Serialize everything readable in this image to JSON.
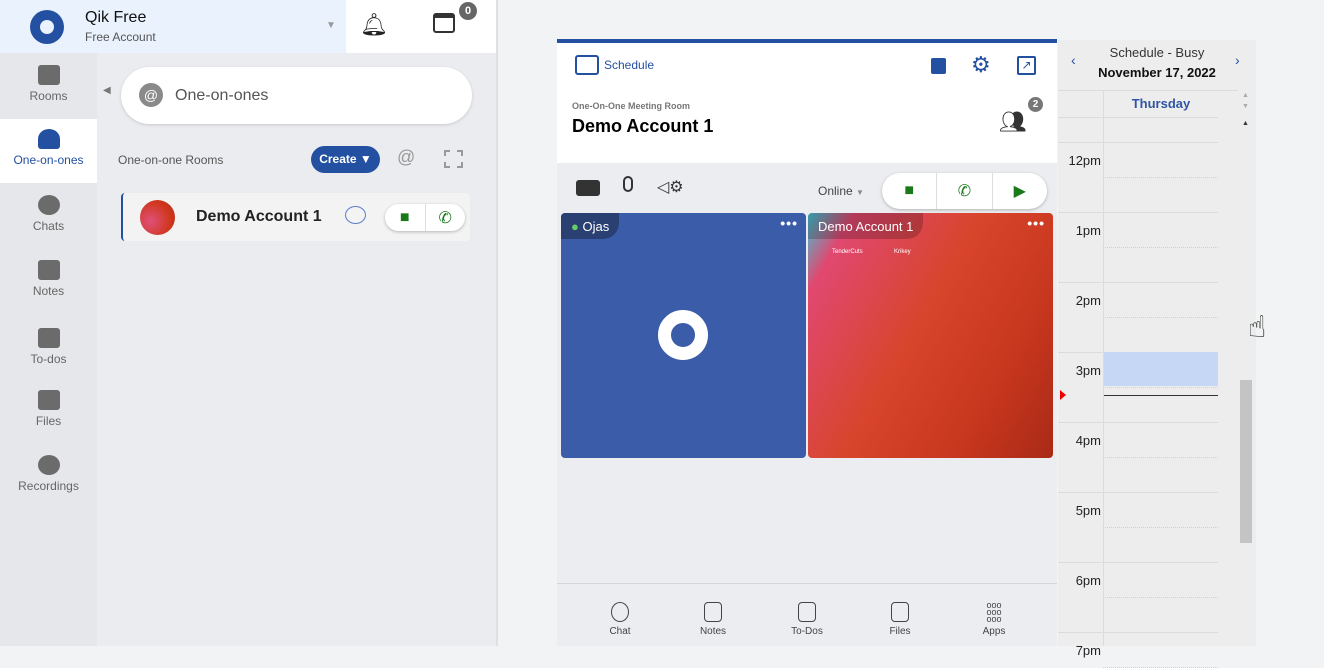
{
  "header": {
    "app_name": "Qik Free",
    "account": "Free Account",
    "calendar_badge": "0"
  },
  "sidebar": {
    "items": [
      {
        "label": "Rooms",
        "icon": "rooms-icon"
      },
      {
        "label": "One-on-ones",
        "icon": "people-icon",
        "active": true
      },
      {
        "label": "Chats",
        "icon": "chats-icon"
      },
      {
        "label": "Notes",
        "icon": "notes-icon"
      },
      {
        "label": "To-dos",
        "icon": "todos-icon"
      },
      {
        "label": "Files",
        "icon": "files-icon"
      },
      {
        "label": "Recordings",
        "icon": "recordings-icon"
      }
    ]
  },
  "panel": {
    "search_value": "One-on-ones",
    "section_label": "One-on-one Rooms",
    "create_label": "Create ▼",
    "rooms": [
      {
        "name": "Demo Account 1"
      }
    ]
  },
  "meeting": {
    "schedule_label": "Schedule",
    "room_type": "One-On-One Meeting Room",
    "room_name": "Demo Account 1",
    "participants_count": "2",
    "status": "Online",
    "tiles": [
      {
        "name": "Ojas",
        "color": "#3b5ca8"
      },
      {
        "name": "Demo Account 1",
        "overlay": [
          "TenderCuts",
          "Krikey"
        ]
      }
    ],
    "bottom": [
      {
        "label": "Chat"
      },
      {
        "label": "Notes"
      },
      {
        "label": "To-Dos"
      },
      {
        "label": "Files"
      },
      {
        "label": "Apps"
      }
    ]
  },
  "calendar": {
    "title": "Schedule - Busy",
    "date": "November 17, 2022",
    "day": "Thursday",
    "times": [
      "12pm",
      "1pm",
      "2pm",
      "3pm",
      "4pm",
      "5pm",
      "6pm",
      "7pm"
    ],
    "highlight_color": "#c5d7f5"
  },
  "colors": {
    "brand": "#2350a0",
    "call_green": "#1a7a1a"
  }
}
